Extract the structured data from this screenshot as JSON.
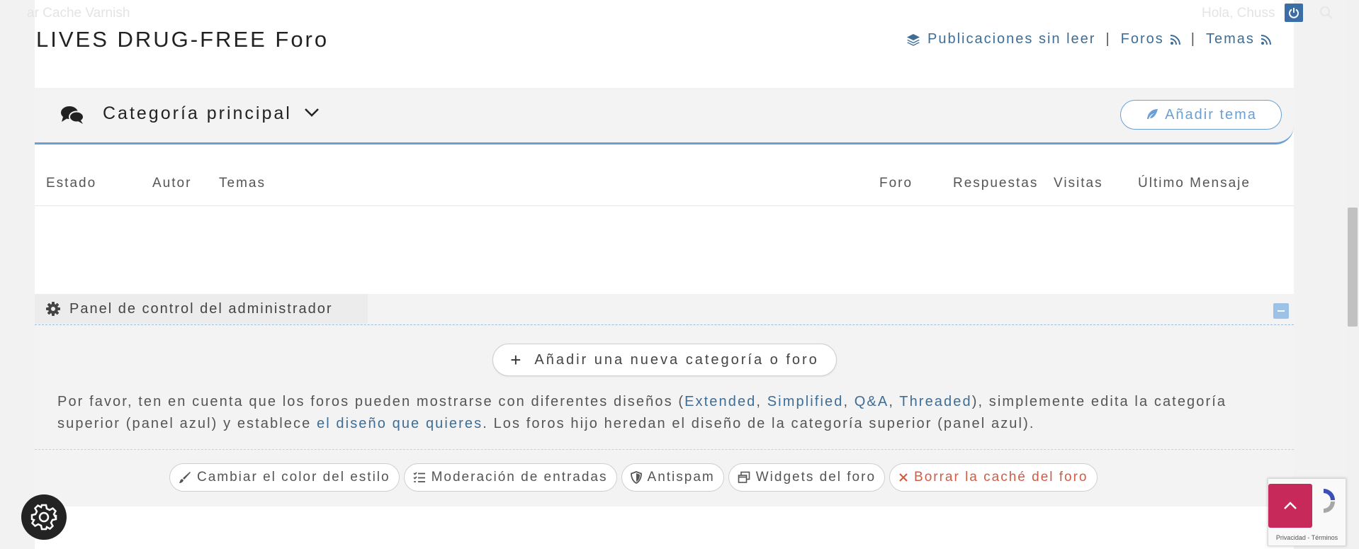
{
  "topbar": {
    "left_text": "ar Cache Varnish",
    "right_text": "Hola, Chuss"
  },
  "header": {
    "title": "LIVES DRUG-FREE Foro",
    "links": {
      "unread": "Publicaciones sin leer",
      "forums": "Foros",
      "topics": "Temas",
      "separator": "|"
    }
  },
  "category": {
    "title": "Categoría principal",
    "add_topic": "Añadir tema"
  },
  "table": {
    "columns": {
      "estado": "Estado",
      "autor": "Autor",
      "temas": "Temas",
      "foro": "Foro",
      "respuestas": "Respuestas",
      "visitas": "Visitas",
      "ultimo": "Último Mensaje"
    }
  },
  "admin": {
    "panel_title": "Panel de control del administrador",
    "new_category_button": "Añadir una nueva categoría o foro",
    "info": {
      "p1": "Por favor, ten en cuenta que los foros pueden mostrarse con diferentes diseños (",
      "l_extended": "Extended",
      "c1": ", ",
      "l_simplified": "Simplified",
      "c2": ", ",
      "l_qa": "Q&A",
      "c3": ", ",
      "l_threaded": "Threaded",
      "p2": "), simplemente edita la categoría superior (panel azul) y establece ",
      "l_layout": "el diseño que quieres",
      "p3": ". Los foros hijo heredan el diseño de la categoría superior (panel azul)."
    },
    "tools": {
      "style": "Cambiar el color del estilo",
      "moderation": "Moderación de entradas",
      "antispam": "Antispam",
      "widgets": "Widgets del foro",
      "cache": "Borrar la caché del foro"
    }
  },
  "recaptcha": {
    "text": "Privacidad - Términos"
  },
  "colors": {
    "accent": "#6aa0d6",
    "link": "#3e6d96",
    "danger": "#d15c45",
    "to_top": "#c7295a"
  }
}
